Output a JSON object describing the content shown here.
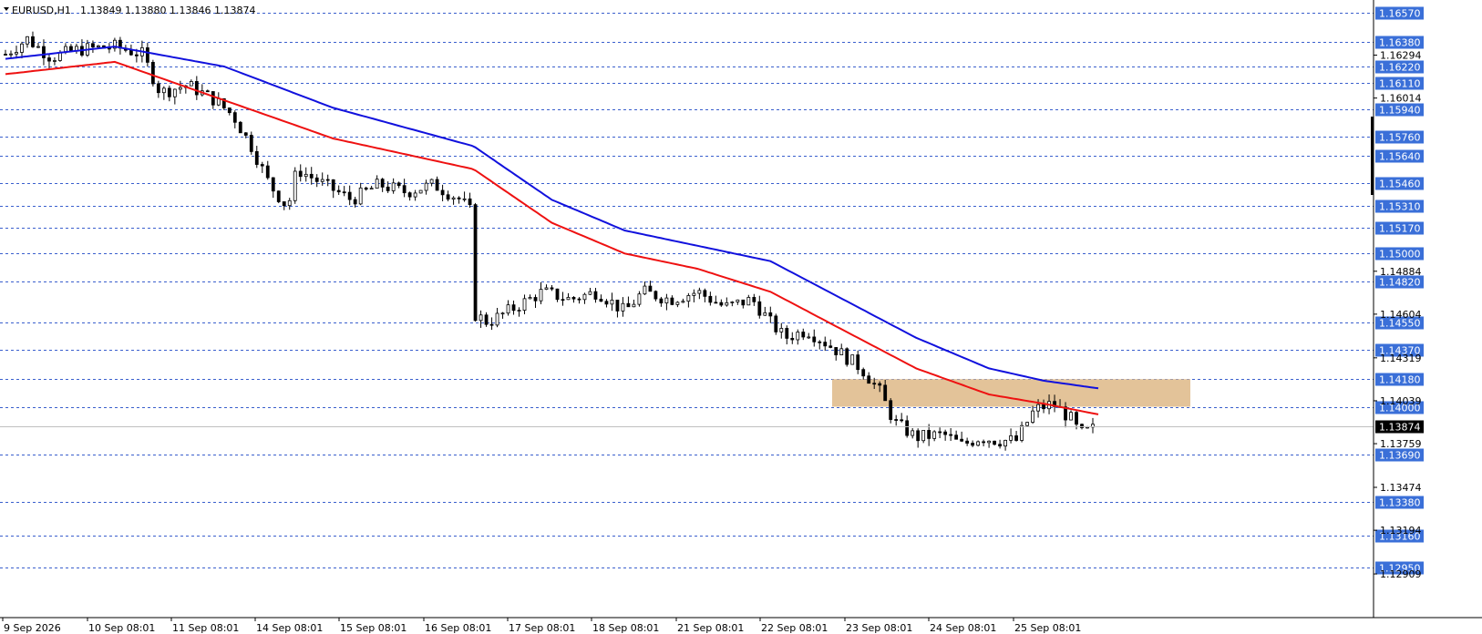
{
  "header": {
    "symbol_timeframe": "EURUSD,H1",
    "ohlc": "1.13849 1.13880 1.13846 1.13874"
  },
  "colors": {
    "background": "#ffffff",
    "candle": "#000000",
    "level_line": "#3a5fcd",
    "level_label_bg": "#3a6fd8",
    "zone_fill": "#deb887",
    "ma_fast": "#ee1111",
    "ma_slow": "#1111dd",
    "current_price_bg": "#000000"
  },
  "chart_data": {
    "type": "candlestick",
    "symbol": "EURUSD",
    "timeframe": "H1",
    "ylim": [
      1.1285,
      1.1663
    ],
    "x_tick_labels": [
      "9 Sep 2026",
      "10 Sep 08:01",
      "11 Sep 08:01",
      "14 Sep 08:01",
      "15 Sep 08:01",
      "16 Sep 08:01",
      "17 Sep 08:01",
      "18 Sep 08:01",
      "21 Sep 08:01",
      "22 Sep 08:01",
      "23 Sep 08:01",
      "24 Sep 08:01",
      "25 Sep 08:01"
    ],
    "y_axis_ticks": [
      "1.16294",
      "1.16014",
      "1.14884",
      "1.14604",
      "1.14319",
      "1.14039",
      "1.13759",
      "1.13474",
      "1.13194",
      "1.12909"
    ],
    "horizontal_levels": [
      1.1657,
      1.1638,
      1.1622,
      1.1611,
      1.1594,
      1.1576,
      1.1564,
      1.1546,
      1.1531,
      1.1517,
      1.15,
      1.1482,
      1.1455,
      1.1437,
      1.1418,
      1.14,
      1.1369,
      1.1338,
      1.1316,
      1.1295
    ],
    "horizontal_level_labels": [
      "1.16570",
      "1.16380",
      "1.16220",
      "1.16110",
      "1.15940",
      "1.15760",
      "1.15640",
      "1.15460",
      "1.15310",
      "1.15170",
      "1.15000",
      "1.14820",
      "1.14550",
      "1.14370",
      "1.14180",
      "1.14000",
      "1.13690",
      "1.13380",
      "1.13160",
      "1.12950"
    ],
    "zone": {
      "top": 1.1418,
      "bottom": 1.14,
      "start_label": "23 Sep 08:01"
    },
    "current_price": 1.13874,
    "current_price_label": "1.13874",
    "price_path": [
      [
        0,
        1.163
      ],
      [
        12,
        1.164
      ],
      [
        25,
        1.1628
      ],
      [
        40,
        1.1633
      ],
      [
        60,
        1.1635
      ],
      [
        75,
        1.163
      ],
      [
        85,
        1.1605
      ],
      [
        100,
        1.161
      ],
      [
        115,
        1.16
      ],
      [
        125,
        1.159
      ],
      [
        135,
        1.157
      ],
      [
        145,
        1.1545
      ],
      [
        155,
        1.153
      ],
      [
        160,
        1.1555
      ],
      [
        175,
        1.1545
      ],
      [
        190,
        1.1535
      ],
      [
        205,
        1.1545
      ],
      [
        220,
        1.154
      ],
      [
        235,
        1.1545
      ],
      [
        250,
        1.1535
      ],
      [
        257,
        1.1525
      ],
      [
        258,
        1.146
      ],
      [
        265,
        1.1455
      ],
      [
        280,
        1.1465
      ],
      [
        295,
        1.1475
      ],
      [
        310,
        1.147
      ],
      [
        325,
        1.1475
      ],
      [
        340,
        1.1462
      ],
      [
        350,
        1.1475
      ],
      [
        365,
        1.147
      ],
      [
        380,
        1.1475
      ],
      [
        395,
        1.1465
      ],
      [
        410,
        1.147
      ],
      [
        420,
        1.1455
      ],
      [
        428,
        1.1445
      ],
      [
        440,
        1.145
      ],
      [
        455,
        1.1438
      ],
      [
        470,
        1.1425
      ],
      [
        480,
        1.141
      ],
      [
        488,
        1.139
      ],
      [
        500,
        1.138
      ],
      [
        515,
        1.1382
      ],
      [
        525,
        1.1375
      ],
      [
        535,
        1.138
      ],
      [
        545,
        1.1378
      ],
      [
        555,
        1.1378
      ],
      [
        565,
        1.1398
      ],
      [
        575,
        1.1402
      ],
      [
        585,
        1.1392
      ],
      [
        590,
        1.1382
      ],
      [
        600,
        1.1387
      ]
    ],
    "series": [
      {
        "name": "",
        "color": "#ee1111",
        "path": [
          [
            0,
            1.1617
          ],
          [
            60,
            1.1625
          ],
          [
            120,
            1.16
          ],
          [
            180,
            1.1575
          ],
          [
            257,
            1.1555
          ],
          [
            300,
            1.152
          ],
          [
            340,
            1.15
          ],
          [
            380,
            1.149
          ],
          [
            420,
            1.1475
          ],
          [
            460,
            1.145
          ],
          [
            500,
            1.1425
          ],
          [
            540,
            1.1408
          ],
          [
            570,
            1.1402
          ],
          [
            600,
            1.1395
          ]
        ]
      },
      {
        "name": "",
        "color": "#1111dd",
        "path": [
          [
            0,
            1.1627
          ],
          [
            60,
            1.1635
          ],
          [
            120,
            1.1622
          ],
          [
            180,
            1.1595
          ],
          [
            257,
            1.157
          ],
          [
            300,
            1.1535
          ],
          [
            340,
            1.1515
          ],
          [
            380,
            1.1505
          ],
          [
            420,
            1.1495
          ],
          [
            460,
            1.147
          ],
          [
            500,
            1.1445
          ],
          [
            540,
            1.1425
          ],
          [
            570,
            1.1417
          ],
          [
            600,
            1.1412
          ]
        ]
      }
    ]
  }
}
